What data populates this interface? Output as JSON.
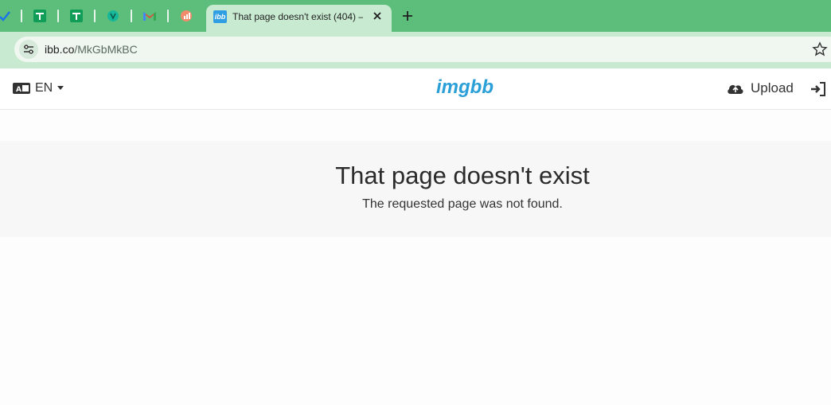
{
  "browser": {
    "active_tab_title": "That page doesn't exist (404) —",
    "active_tab_favicon_text": "ibb",
    "url_domain": "ibb.co",
    "url_path": "/MkGbMkBC"
  },
  "site": {
    "lang_label": "EN",
    "logo_text": "imgbb",
    "upload_label": "Upload"
  },
  "error": {
    "title": "That page doesn't exist",
    "subtitle": "The requested page was not found."
  },
  "colors": {
    "tabstrip": "#5dbd7a",
    "active_tab": "#c8ead1",
    "logo": "#2a9fd8"
  }
}
